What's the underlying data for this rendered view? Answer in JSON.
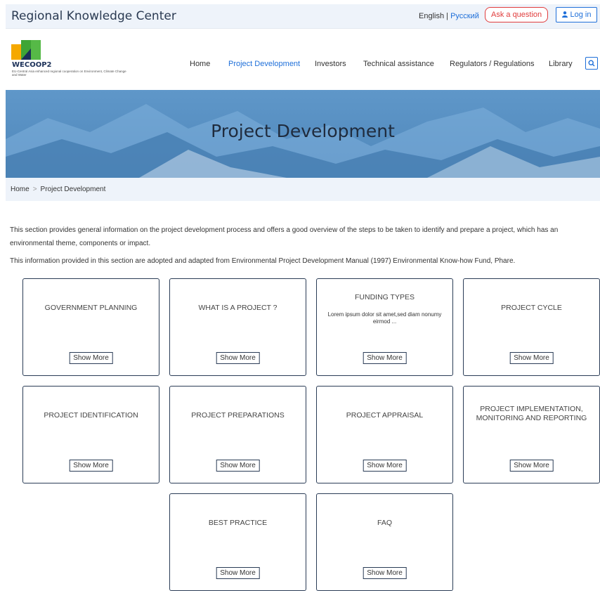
{
  "header": {
    "site_title": "Regional Knowledge Center",
    "lang_en": "English",
    "lang_sep": " | ",
    "lang_ru": "Русский",
    "ask_label": "Ask a question",
    "login_label": "Log in"
  },
  "brand": {
    "name": "WECOOP2",
    "tagline": "EU-Central Asia enhanced regional cooperation on Environment, Climate Change and Water",
    "colors": [
      "#f5a800",
      "#3fa535",
      "#1b3058",
      "#56b947"
    ]
  },
  "nav": {
    "items": [
      {
        "label": "Home"
      },
      {
        "label": "Project Development"
      },
      {
        "label": "Investors"
      },
      {
        "label": "Technical assistance"
      },
      {
        "label": "Regulators / Regulations"
      },
      {
        "label": "Library"
      }
    ],
    "search_icon": "search-icon"
  },
  "hero": {
    "title": "Project Development"
  },
  "breadcrumb": {
    "home": "Home",
    "sep": ">",
    "current": "Project Development"
  },
  "intro": {
    "p1": "This section provides general information on the project development process and offers a good overview of the steps to be taken to identify and prepare a project, which has an environmental theme, components or impact.",
    "p2": "This information provided in this section are adopted and adapted from Environmental Project Development Manual (1997) Environmental Know-how Fund, Phare."
  },
  "cards": [
    {
      "title": "GOVERNMENT PLANNING",
      "desc": "",
      "button": "Show More"
    },
    {
      "title": "WHAT IS A PROJECT ?",
      "desc": "",
      "button": "Show More"
    },
    {
      "title": "FUNDING TYPES",
      "desc": "Lorem ipsum dolor sit amet,sed diam nonumy eirmod ...",
      "button": "Show More"
    },
    {
      "title": "PROJECT CYCLE",
      "desc": "",
      "button": "Show More"
    },
    {
      "title": "PROJECT IDENTIFICATION",
      "desc": "",
      "button": "Show More"
    },
    {
      "title": "PROJECT PREPARATIONS",
      "desc": "",
      "button": "Show More"
    },
    {
      "title": "PROJECT APPRAISAL",
      "desc": "",
      "button": "Show More"
    },
    {
      "title": "PROJECT IMPLEMENTATION, MONITORING AND REPORTING",
      "desc": "",
      "button": "Show More"
    },
    {
      "title": "BEST PRACTICE",
      "desc": "",
      "button": "Show More"
    },
    {
      "title": "FAQ",
      "desc": "",
      "button": "Show More"
    }
  ]
}
